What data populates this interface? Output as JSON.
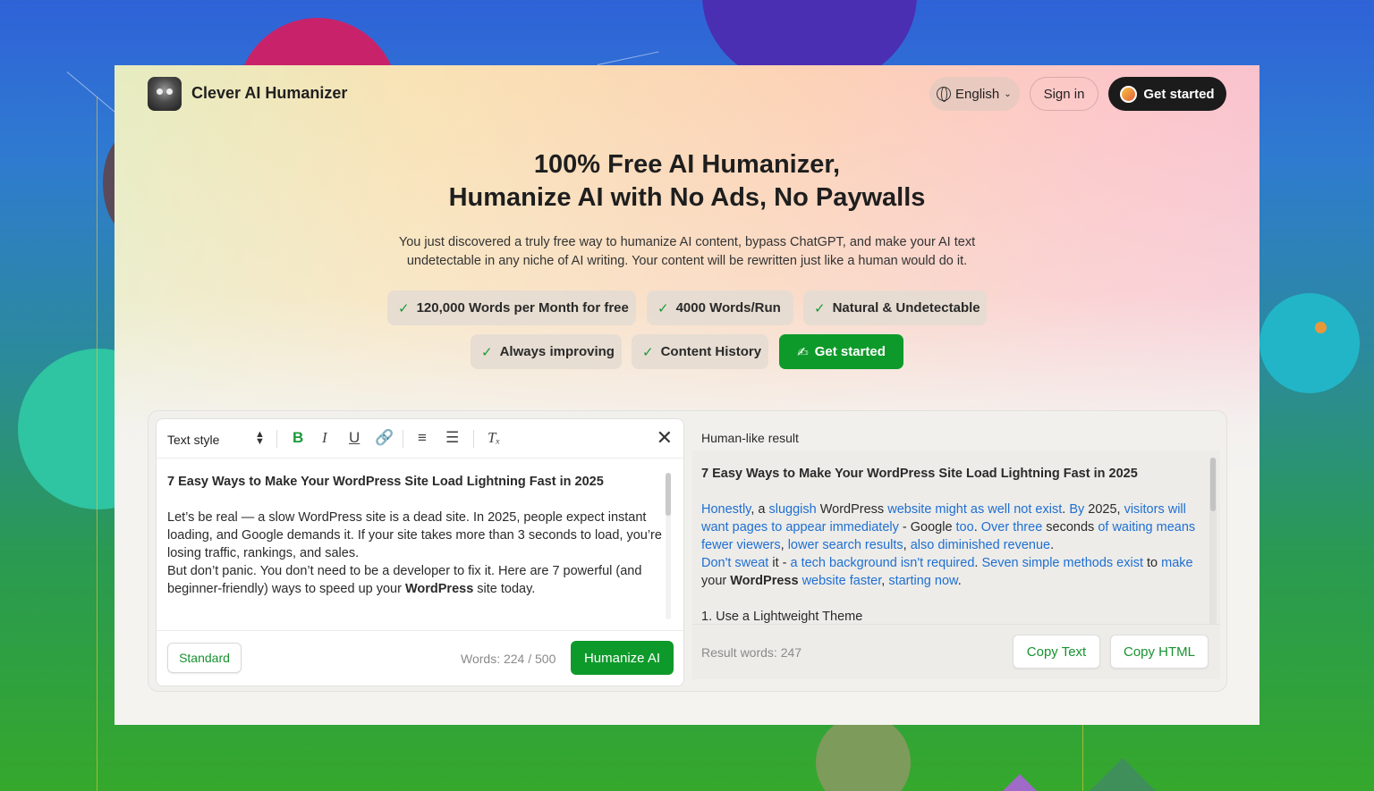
{
  "brand": {
    "name": "Clever AI Humanizer"
  },
  "header": {
    "language": "English",
    "sign_in": "Sign in",
    "get_started": "Get started"
  },
  "hero": {
    "title_line1": "100% Free AI Humanizer,",
    "title_line2": "Humanize AI with No Ads, No Paywalls",
    "subtitle_line1": "You just discovered a truly free way to humanize AI content, bypass ChatGPT, and make your AI text",
    "subtitle_line2": "undetectable in any niche of AI writing. Your content will be rewritten just like a human would do it."
  },
  "features": [
    "120,000 Words per Month for free",
    "4000 Words/Run",
    "Natural & Undetectable",
    "Always improving",
    "Content History"
  ],
  "features_cta": "Get started",
  "editor": {
    "text_style": "Text style",
    "heading": "7 Easy Ways to Make Your WordPress Site Load Lightning Fast in 2025",
    "para1": "Let’s be real — a slow WordPress site is a dead site. In 2025, people expect instant loading, and Google demands it. If your site takes more than 3 seconds to load, you’re losing traffic, rankings, and sales.",
    "para2_before": "But don’t panic. You don’t need to be a developer to fix it. Here are 7 powerful (and beginner-friendly) ways to speed up your ",
    "para2_bold": "WordPress",
    "para2_after": " site today.",
    "mode_button": "Standard",
    "word_count": "Words: 224 / 500",
    "humanize_button": "Humanize AI"
  },
  "result": {
    "header": "Human-like result",
    "heading": "7 Easy Ways to Make Your WordPress Site Load Lightning Fast in 2025",
    "list_item": "1. Use a Lightweight Theme",
    "word_count": "Result words: 247",
    "copy_text": "Copy Text",
    "copy_html": "Copy HTML"
  },
  "colors": {
    "accent": "#0e9a2a",
    "link": "#1f6fd1",
    "dark": "#1b1b1b"
  }
}
